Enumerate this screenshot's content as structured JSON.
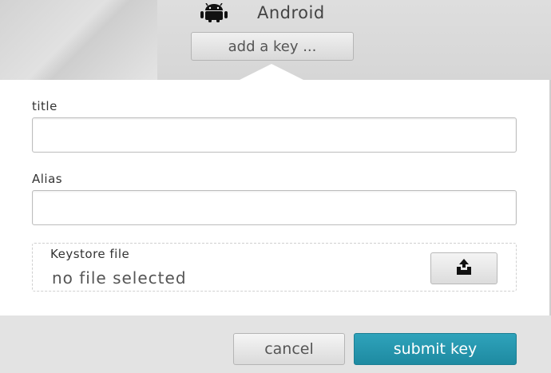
{
  "header": {
    "platform_icon": "android-icon",
    "platform_name": "Android",
    "add_key_label": "add a key ..."
  },
  "form": {
    "title_label": "title",
    "title_value": "",
    "alias_label": "Alias",
    "alias_value": "",
    "keystore_label": "Keystore file",
    "keystore_status": "no file selected",
    "upload_icon": "upload-icon"
  },
  "footer": {
    "cancel_label": "cancel",
    "submit_label": "submit key"
  },
  "colors": {
    "submit_accent": "#1e8aa1",
    "footer_bg": "#e3e3e3",
    "header_bg": "#d8d8d8"
  }
}
